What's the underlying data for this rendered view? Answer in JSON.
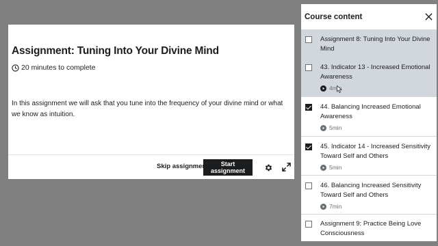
{
  "assignment": {
    "title": "Assignment: Tuning Into Your Divine Mind",
    "duration": "20 minutes to complete",
    "description": "In this assignment we will ask that you tune into the frequency of your divine mind or what we know as intuition.",
    "skip_label": "Skip assignment",
    "start_label": "Start assignment"
  },
  "sidebar": {
    "title": "Course content",
    "items": [
      {
        "title": "Assignment 8: Tuning Into Your Divine Mind",
        "checked": false,
        "active": true,
        "meta": ""
      },
      {
        "title": "43. Indicator 13 - Increased Emotional Awareness",
        "checked": false,
        "active": true,
        "meta": "4min"
      },
      {
        "title": "44. Balancing Increased Emotional Awareness",
        "checked": true,
        "active": false,
        "meta": "5min"
      },
      {
        "title": "45. Indicator 14 - Increased Sensitivity Toward Self and Others",
        "checked": true,
        "active": false,
        "meta": "5min"
      },
      {
        "title": "46. Balancing Increased Sensitivity Toward Self and Others",
        "checked": false,
        "active": false,
        "meta": "7min"
      },
      {
        "title": "Assignment 9: Practice Being Love Consciousness",
        "checked": false,
        "active": false,
        "meta": ""
      }
    ]
  },
  "icons": [
    "clock-icon",
    "gear-icon",
    "expand-icon",
    "close-icon",
    "play-icon"
  ],
  "colors": {
    "overlay": "#808080",
    "active_item": "#d1d7dc",
    "dark_button": "#1c1d1f"
  }
}
